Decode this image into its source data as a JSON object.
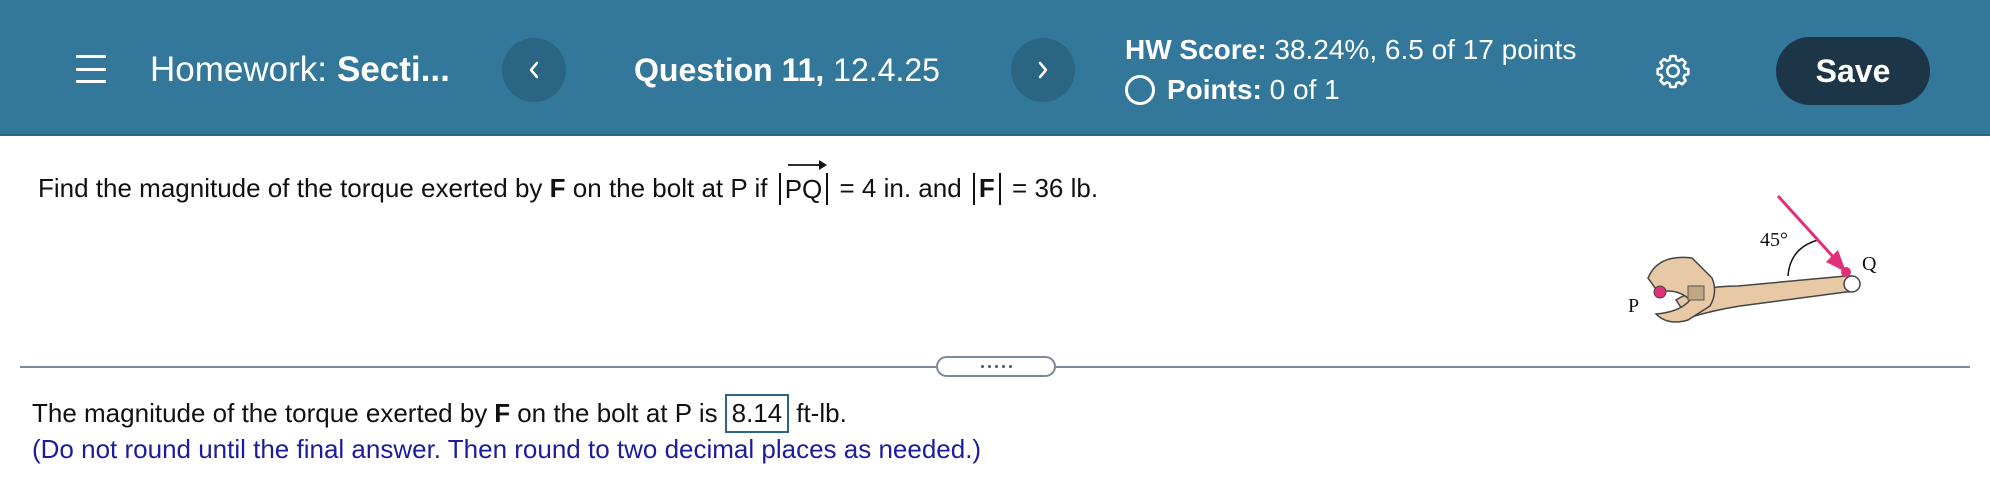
{
  "header": {
    "menu_icon": "hamburger-menu-icon",
    "homework_label": "Homework:",
    "homework_name": "Secti...",
    "prev_icon": "chevron-left-icon",
    "next_icon": "chevron-right-icon",
    "question_label": "Question 11,",
    "question_id": "12.4.25",
    "hw_score_label": "HW Score:",
    "hw_score_value": "38.24%, 6.5 of 17 points",
    "points_label": "Points:",
    "points_value": "0 of 1",
    "settings_icon": "gear-icon",
    "save_label": "Save",
    "colors": {
      "header_bg": "#33789a",
      "save_bg": "#1c3547"
    }
  },
  "question": {
    "part1": "Find the magnitude of the torque exerted by",
    "force_symbol": "F",
    "part2": "on the bolt at P if",
    "vector_label": "PQ",
    "part3": "= 4 in. and",
    "force_abs_symbol": "F",
    "part4": "= 36 lb."
  },
  "figure": {
    "angle_label": "45°",
    "label_p": "P",
    "label_q": "Q",
    "arrow_color": "#e0307a"
  },
  "answer": {
    "part1": "The magnitude of the torque exerted by",
    "force_symbol": "F",
    "part2": "on the bolt at P is",
    "value": "8.14",
    "unit": "ft-lb.",
    "hint": "(Do not round until the final answer. Then round to two decimal places as needed.)"
  }
}
